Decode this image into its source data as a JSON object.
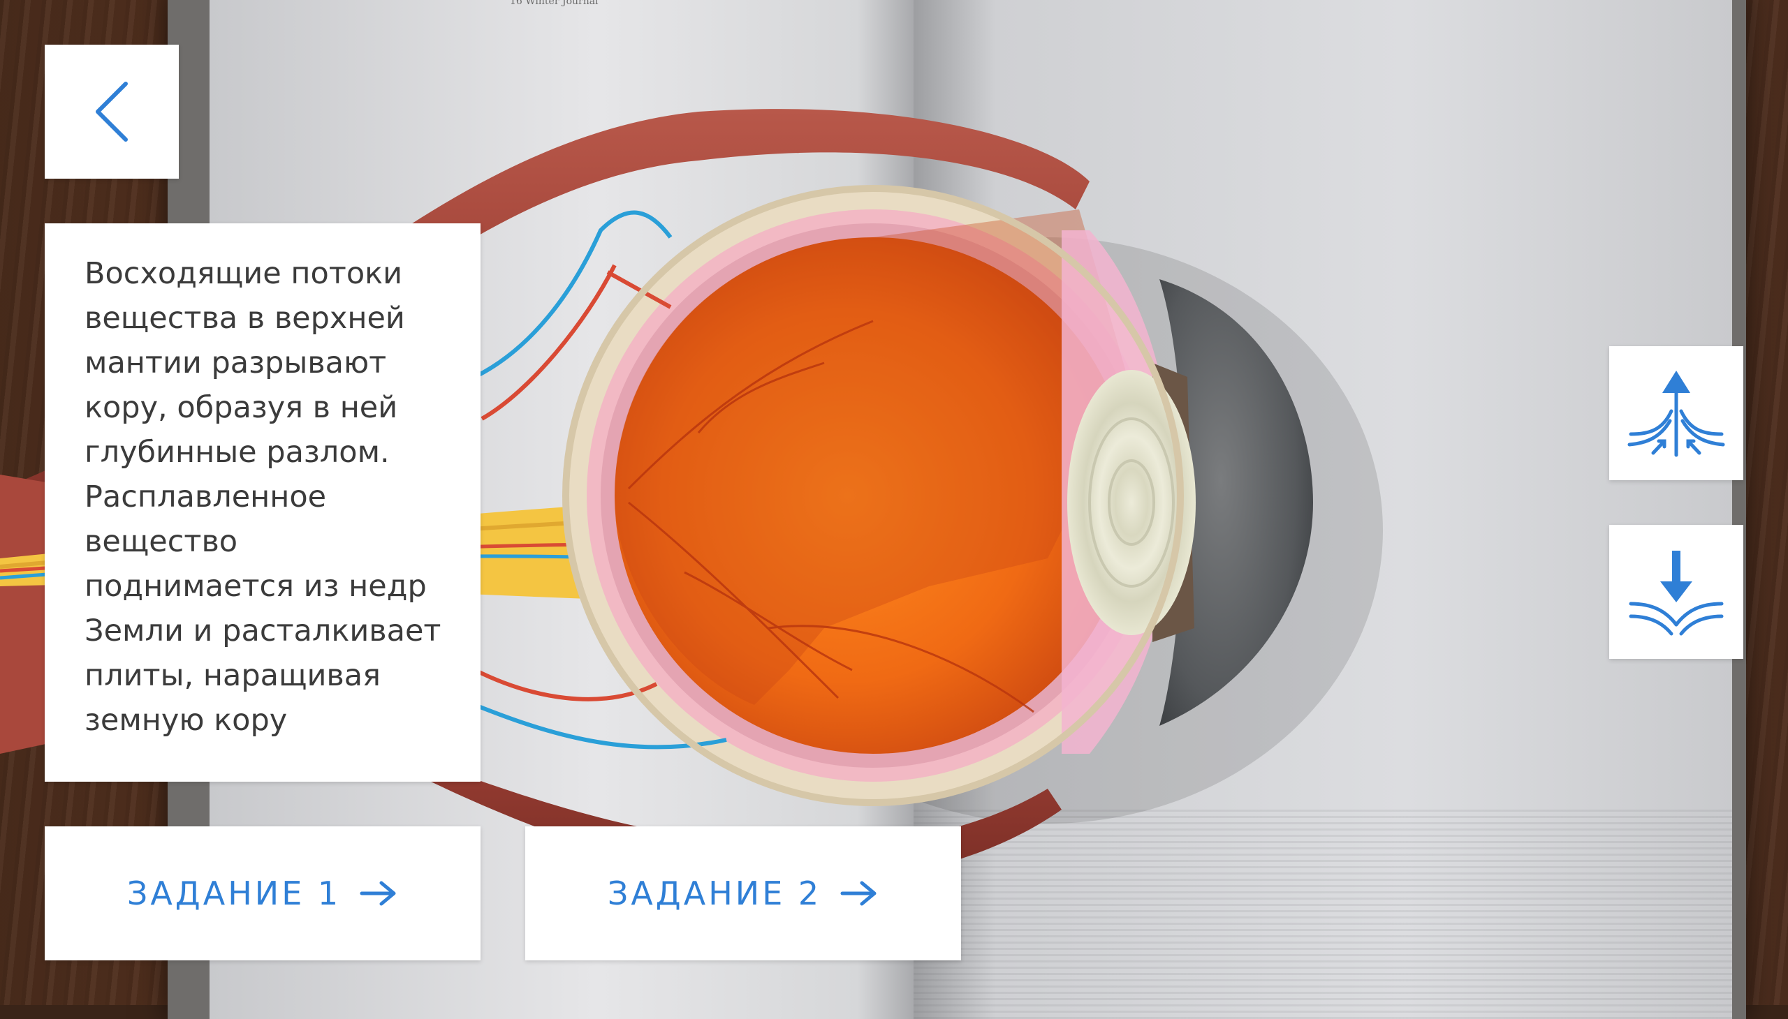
{
  "colors": {
    "accent": "#2f7fd6",
    "panel": "#ffffff",
    "text": "#3b3b3b"
  },
  "header": {
    "back_icon": "chevron-left-icon",
    "book_running_head": "16 Winter Journal"
  },
  "info_card": {
    "text": "Восходящие потоки\nвещества в верхней\nмантии разрывают\nкору, образуя в ней\nглубинные разлом.\nРасплавленное\nвещество\nподнимается из недр\nЗемли и расталкивает\nплиты, наращивая\nземную кору"
  },
  "tasks": [
    {
      "label": "ЗАДАНИЕ 1",
      "icon": "arrow-right-icon"
    },
    {
      "label": "ЗАДАНИЕ 2",
      "icon": "arrow-right-icon"
    }
  ],
  "side_controls": {
    "upwelling_icon": "upwelling-arrow-icon",
    "subduction_icon": "subduction-arrow-icon"
  }
}
